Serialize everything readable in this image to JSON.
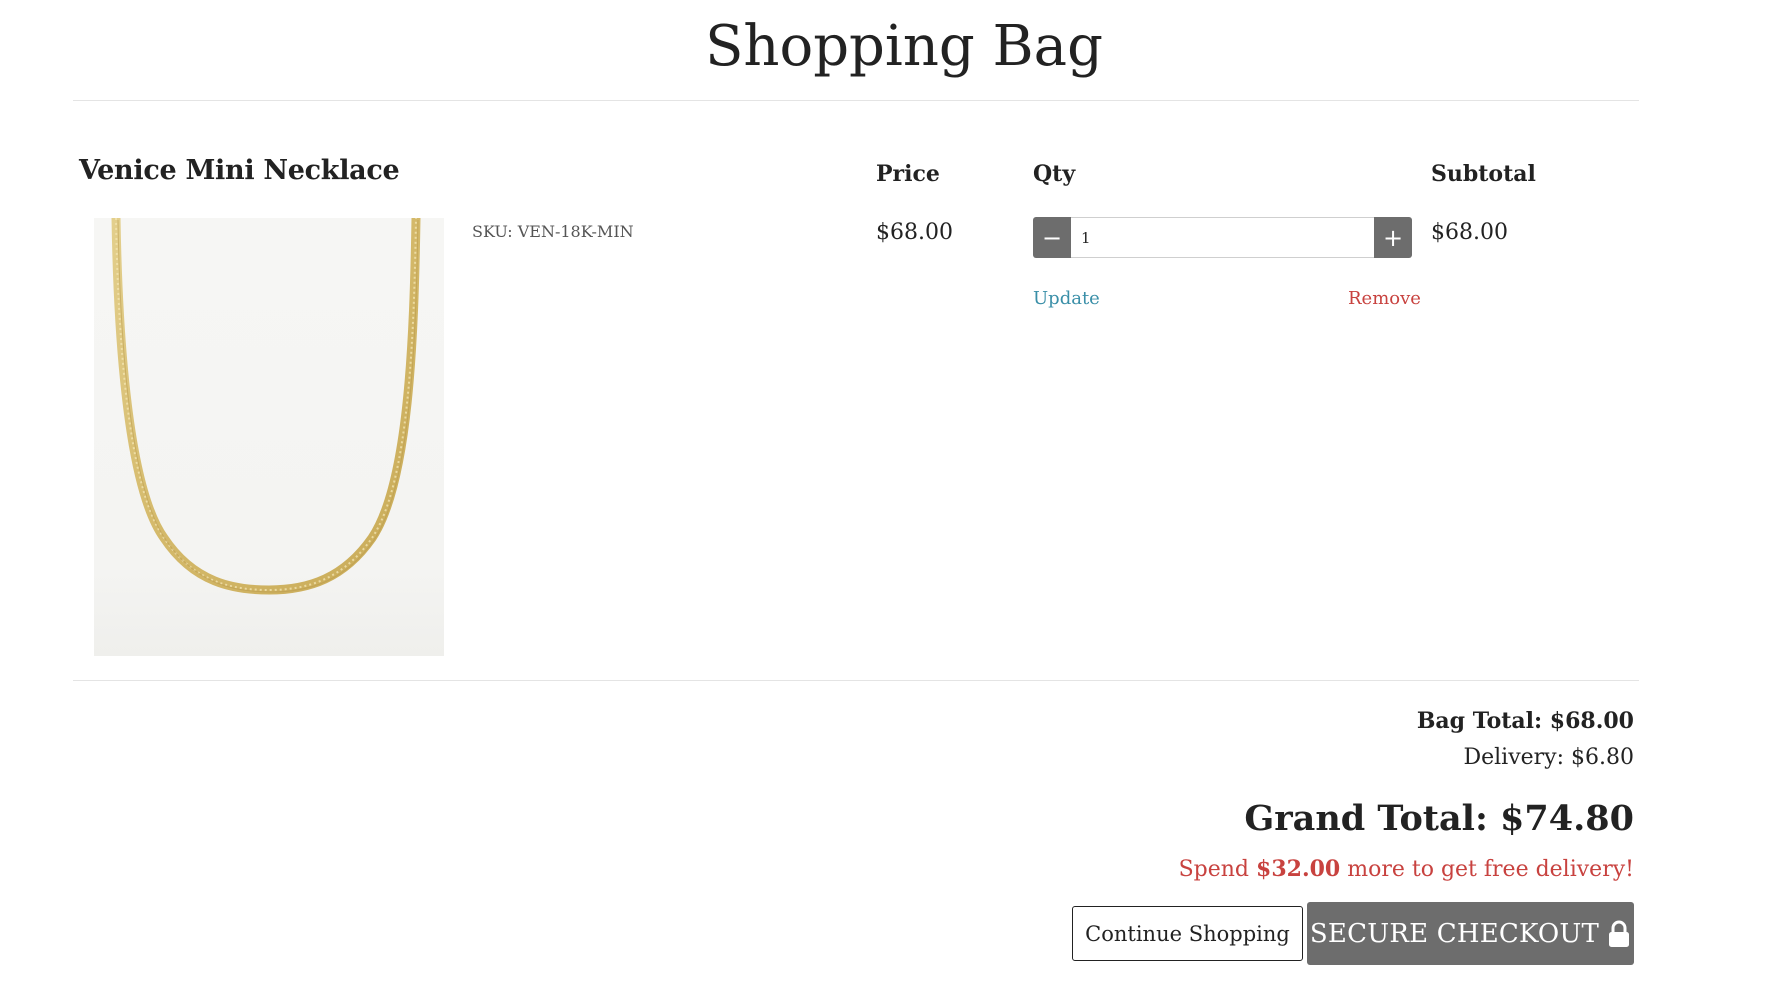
{
  "page": {
    "title": "Shopping Bag"
  },
  "columns": {
    "price": "Price",
    "qty": "Qty",
    "subtotal": "Subtotal"
  },
  "cart_item": {
    "name": "Venice Mini Necklace",
    "sku": "SKU: VEN-18K-MIN",
    "price": "$68.00",
    "quantity": "1",
    "subtotal": "$68.00",
    "update_label": "Update",
    "remove_label": "Remove",
    "image_icon": "gold-snake-chain-necklace"
  },
  "summary": {
    "bag_total": "Bag Total: $68.00",
    "delivery": "Delivery: $6.80",
    "grand_total": "Grand Total: $74.80",
    "free_delivery_prefix": "Spend",
    "free_delivery_amount": "$32.00",
    "free_delivery_suffix": "more to get free delivery!"
  },
  "actions": {
    "continue_label": "Continue Shopping",
    "checkout_label": "SECURE CHECKOUT",
    "checkout_icon": "lock-icon"
  },
  "colors": {
    "accent_gray": "#6d6d6d",
    "link_blue": "#3a8fa8",
    "alert_red": "#c8423f",
    "text": "#222222",
    "gold": "#d9c27a"
  }
}
